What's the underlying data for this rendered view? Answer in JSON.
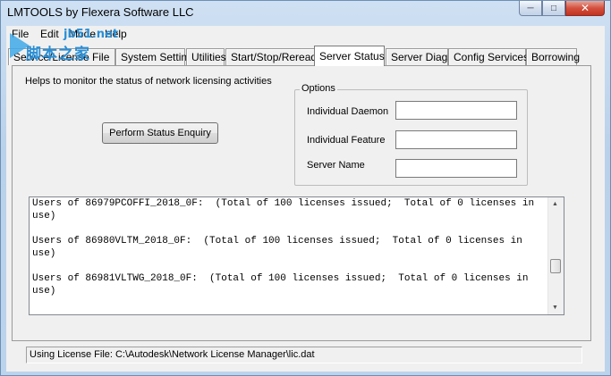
{
  "window": {
    "title": "LMTOOLS by Flexera Software LLC",
    "controls": {
      "minimize": "─",
      "maximize": "□",
      "close": "✕"
    }
  },
  "menu": {
    "items": [
      "File",
      "Edit",
      "Mode",
      "Help"
    ]
  },
  "watermark": {
    "url": "jb51.net",
    "text": "脚本之家"
  },
  "tabs": [
    {
      "label": "Service/License File"
    },
    {
      "label": "System Settings"
    },
    {
      "label": "Utilities"
    },
    {
      "label": "Start/Stop/Reread"
    },
    {
      "label": "Server Status"
    },
    {
      "label": "Server Diags"
    },
    {
      "label": "Config Services"
    },
    {
      "label": "Borrowing"
    }
  ],
  "active_tab": "Server Status",
  "server_status": {
    "help_text": "Helps to monitor the status of network licensing activities",
    "enquiry_button": "Perform Status Enquiry",
    "options": {
      "legend": "Options",
      "individual_daemon": {
        "label": "Individual Daemon",
        "value": ""
      },
      "individual_feature": {
        "label": "Individual Feature",
        "value": ""
      },
      "server_name": {
        "label": "Server Name",
        "value": ""
      }
    },
    "output": [
      "Users of 86979PCOFFI_2018_0F:  (Total of 100 licenses issued;  Total of 0 licenses in use)",
      "Users of 86980VLTM_2018_0F:  (Total of 100 licenses issued;  Total of 0 licenses in use)",
      "Users of 86981VLTWG_2018_0F:  (Total of 100 licenses issued;  Total of 0 licenses in use)"
    ]
  },
  "statusbar": {
    "text": "Using License File:  C:\\Autodesk\\Network License Manager\\lic.dat"
  }
}
